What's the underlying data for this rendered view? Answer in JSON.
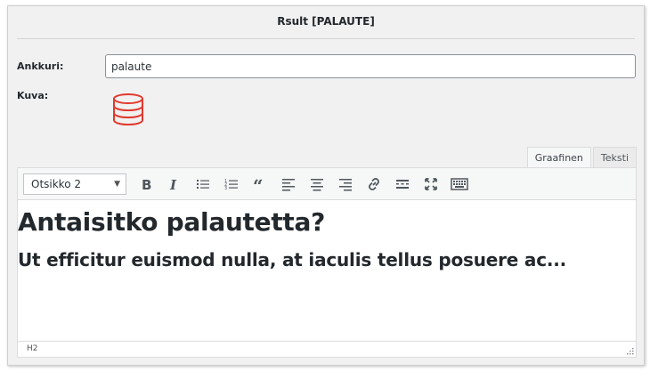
{
  "dialog": {
    "title": "Rsult [PALAUTE]"
  },
  "fields": {
    "anchor_label": "Ankkuri:",
    "anchor_value": "palaute",
    "image_label": "Kuva:",
    "image_icon": "database-icon"
  },
  "tabs": [
    {
      "label": "Graafinen",
      "active": true
    },
    {
      "label": "Teksti",
      "active": false
    }
  ],
  "toolbar": {
    "format_select": "Otsikko 2",
    "buttons": [
      "bold-icon",
      "italic-icon",
      "bullet-list-icon",
      "numbered-list-icon",
      "blockquote-icon",
      "align-left-icon",
      "align-center-icon",
      "align-right-icon",
      "link-icon",
      "read-more-icon",
      "fullscreen-icon",
      "keyboard-icon"
    ]
  },
  "content": {
    "heading1": "Antaisitko palautetta?",
    "heading2": "Ut efficitur euismod nulla, at iaculis tellus posuere ac..."
  },
  "statusbar": {
    "path": "H2"
  },
  "colors": {
    "icon_red": "#e03a2e",
    "panel_bg": "#f1f1f1",
    "text": "#23282d"
  }
}
